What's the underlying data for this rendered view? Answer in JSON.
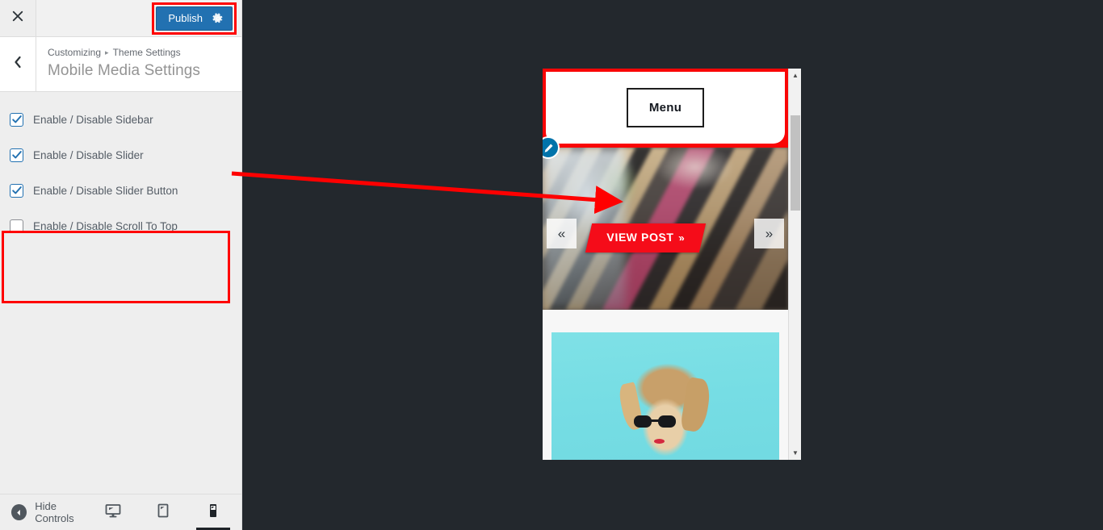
{
  "customizer": {
    "close_icon": "close-icon",
    "publish_label": "Publish",
    "publish_gear_icon": "gear-icon",
    "back_icon": "chevron-left-icon",
    "breadcrumb": {
      "root": "Customizing",
      "separator": "▸",
      "section": "Theme Settings"
    },
    "panel_title": "Mobile Media Settings",
    "controls": [
      {
        "label": "Enable / Disable Sidebar",
        "checked": true
      },
      {
        "label": "Enable / Disable Slider",
        "checked": true
      },
      {
        "label": "Enable / Disable Slider Button",
        "checked": true
      },
      {
        "label": "Enable / Disable Scroll To Top",
        "checked": false
      }
    ],
    "footer": {
      "hide_controls_label": "Hide Controls",
      "hide_controls_icon": "collapse-left-icon",
      "devices": [
        {
          "name": "desktop",
          "icon": "desktop-icon",
          "active": false
        },
        {
          "name": "tablet",
          "icon": "tablet-icon",
          "active": false
        },
        {
          "name": "mobile",
          "icon": "mobile-icon",
          "active": true
        }
      ]
    }
  },
  "preview": {
    "device": "mobile",
    "site": {
      "menu_label": "Menu",
      "edit_shortcut_icon": "pencil-icon",
      "slider": {
        "prev_icon": "«",
        "next_icon": "»",
        "button_label": "VIEW POST",
        "button_chevron": "»"
      }
    },
    "scrollbar": {
      "up_arrow_icon": "▲",
      "down_arrow_icon": "▼"
    }
  },
  "annotations": {
    "highlight_color": "#ff0000",
    "publish_highlight": "Publish",
    "slider_controls_highlight": "Enable / Disable Slider + Enable / Disable Slider Button",
    "arrow_from": "slider controls",
    "arrow_to": "preview slider"
  }
}
